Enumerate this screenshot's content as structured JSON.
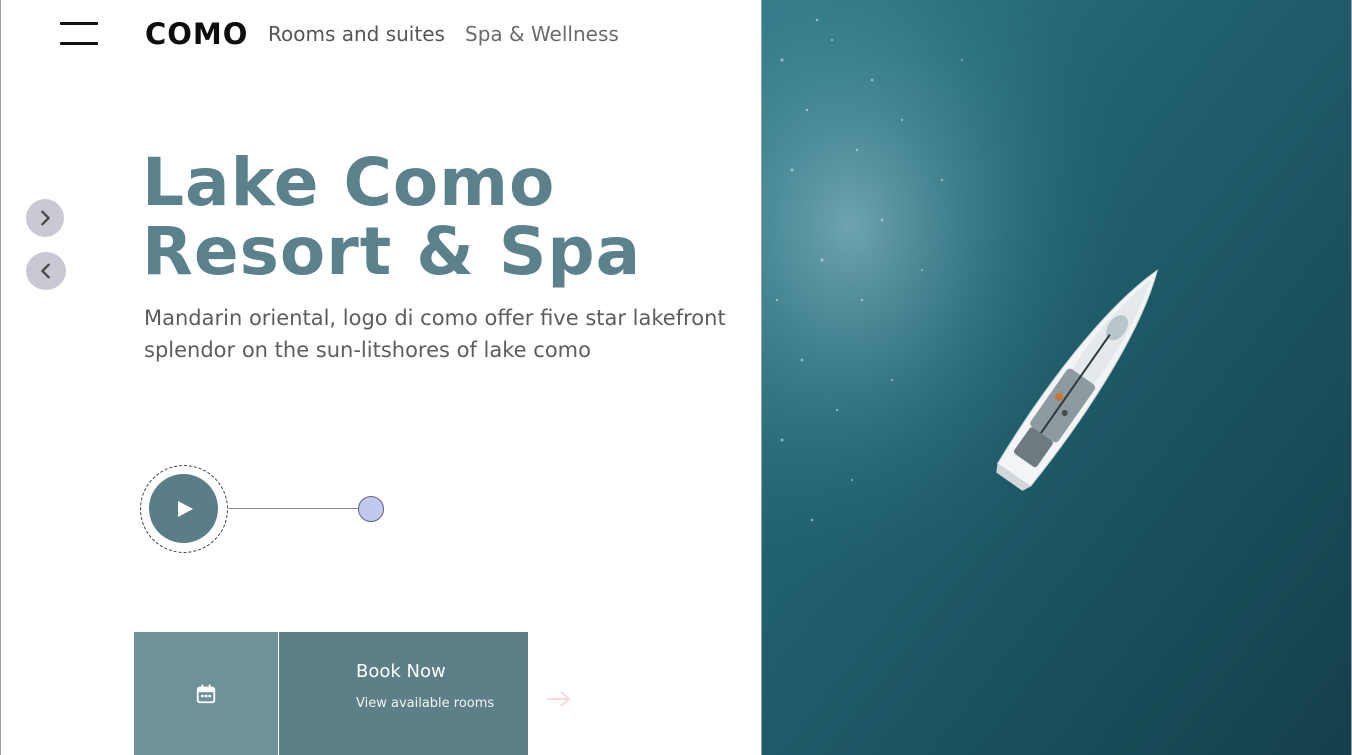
{
  "header": {
    "logo": "COMO",
    "nav": [
      {
        "label": "Rooms and suites"
      },
      {
        "label": "Spa & Wellness"
      }
    ]
  },
  "hero": {
    "title_line1": "Lake Como",
    "title_line2": "Resort & Spa",
    "description": "Mandarin oriental, logo di como offer five star lakefront splendor on the sun-litshores of lake como"
  },
  "booking": {
    "title": "Book Now",
    "subtitle": "View available rooms"
  },
  "colors": {
    "accent": "#5b818d",
    "book_primary": "#5d7f88",
    "book_secondary": "#6f9299",
    "progress_dot": "#c3c8f1",
    "arrow_bg": "#c9c9d3"
  },
  "icons": {
    "menu": "hamburger-menu-icon",
    "next": "chevron-right-icon",
    "prev": "chevron-left-icon",
    "play": "play-icon",
    "calendar": "calendar-icon",
    "arrow": "arrow-right-icon"
  }
}
